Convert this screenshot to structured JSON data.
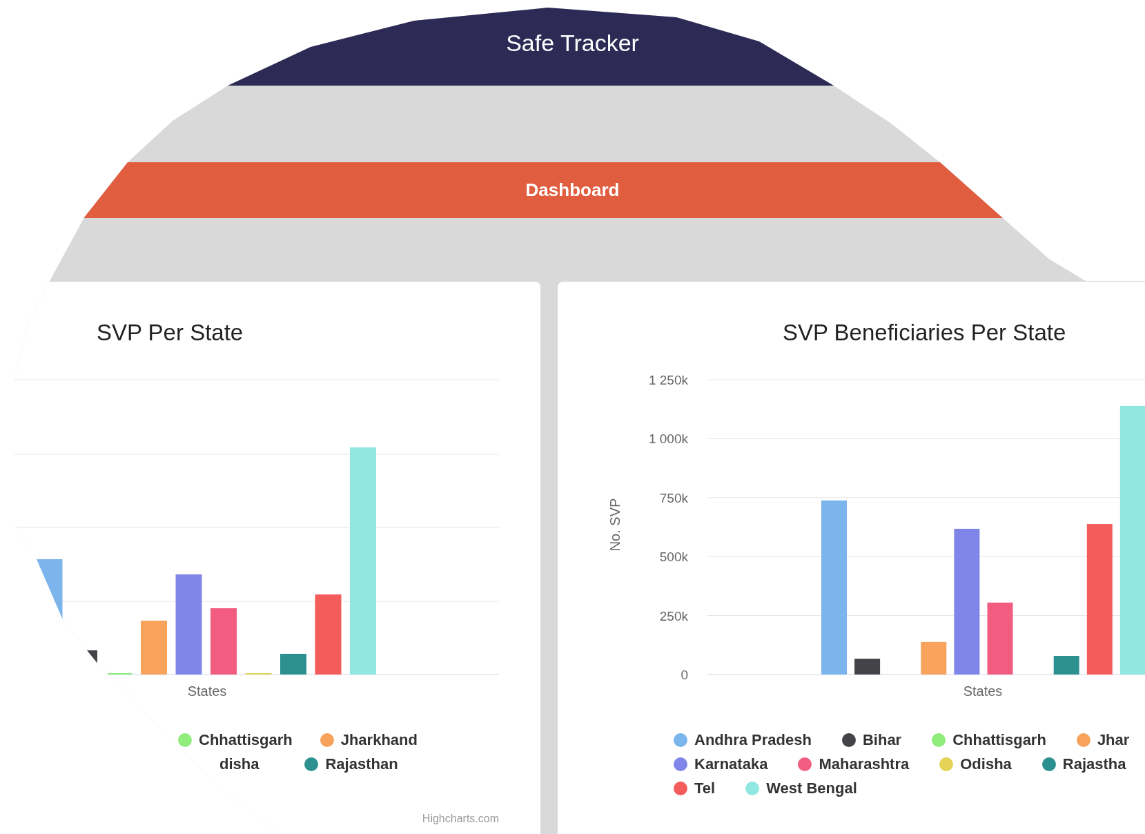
{
  "navbar": {
    "title": "Safe Tracker"
  },
  "menu": {
    "label": "Dashboard"
  },
  "left_panel": {
    "title": "SVP Per State",
    "xlabel": "States",
    "legend_rows": [
      [
        {
          "label": "Chhattisgarh",
          "color": "#90ed7d"
        },
        {
          "label": "Jharkhand",
          "color": "#f7a35c"
        }
      ],
      [
        {
          "label": "disha"
        },
        {
          "label": "Rajasthan",
          "color": "#2b908f"
        }
      ]
    ],
    "credits": "Highcharts.com"
  },
  "right_panel": {
    "chart_data": {
      "type": "bar",
      "grid": true,
      "title": "SVP Beneficiaries Per State",
      "xlabel": "States",
      "ylabel": "No. SVP",
      "ylim": [
        0,
        1250
      ],
      "yticks": [
        0,
        {
          "value": 250,
          "label": "250k"
        },
        {
          "value": 500,
          "label": "500k"
        },
        {
          "value": 750,
          "label": "750k"
        },
        {
          "value": 1000,
          "label": "1 000k"
        },
        {
          "value": 1250,
          "label": "1 250k"
        }
      ],
      "series": [
        {
          "name": "Andhra Pradesh",
          "color": "#7cb5ec",
          "values": [
            738
          ]
        },
        {
          "name": "Bihar",
          "color": "#434348",
          "values": [
            67
          ]
        },
        {
          "name": "Chhattisgarh",
          "color": "#90ed7d",
          "values": [
            0
          ]
        },
        {
          "name": "Jhar",
          "color": "#f7a35c",
          "values": [
            138
          ]
        },
        {
          "name": "Karnataka",
          "color": "#8085e9",
          "values": [
            618
          ]
        },
        {
          "name": "Maharashtra",
          "color": "#f15c80",
          "values": [
            305
          ]
        },
        {
          "name": "Odisha",
          "color": "#e4d354",
          "values": [
            0
          ]
        },
        {
          "name": "Rajastha",
          "color": "#2b908f",
          "values": [
            79
          ]
        },
        {
          "name": "Tel",
          "color": "#f45b5b",
          "values": [
            638
          ]
        },
        {
          "name": "West Bengal",
          "color": "#91e8e1",
          "values": [
            1139
          ]
        }
      ]
    }
  }
}
